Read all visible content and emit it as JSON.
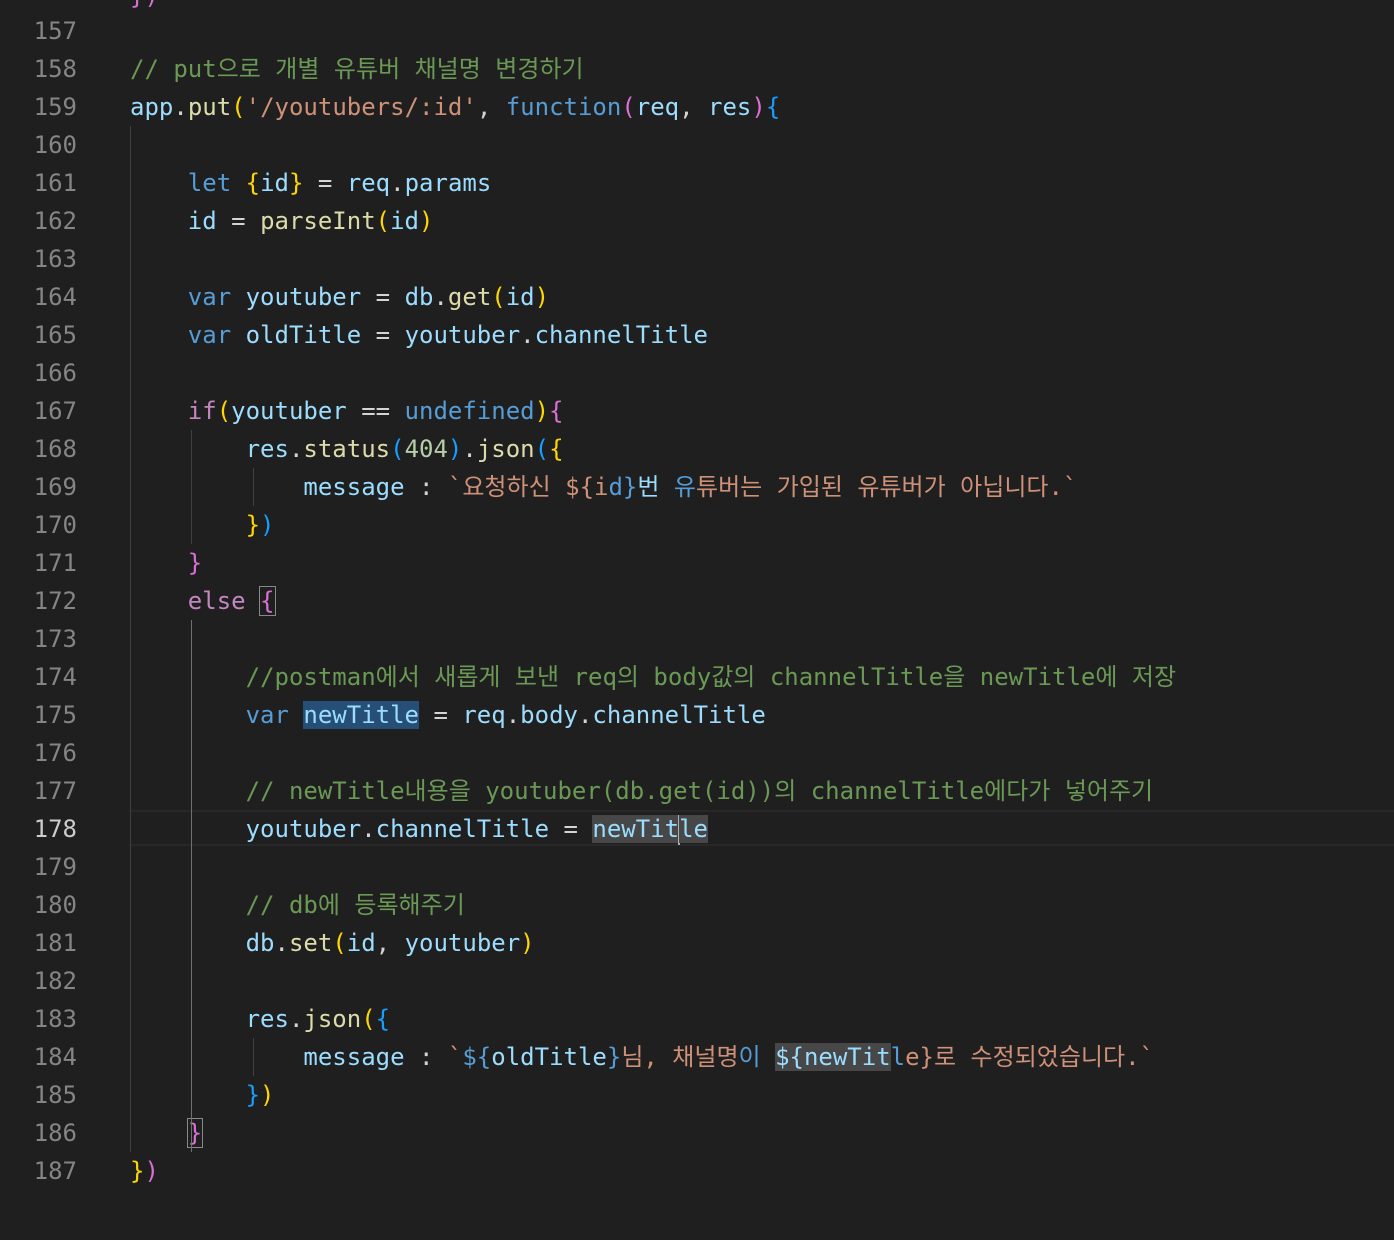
{
  "editor": {
    "active_line": "178",
    "top_partial": "})",
    "lines": [
      {
        "num": "157",
        "code": ""
      },
      {
        "num": "158",
        "code": "// put으로 개별 유튜버 채널명 변경하기"
      },
      {
        "num": "159",
        "code": "app.put('/youtubers/:id', function(req, res){"
      },
      {
        "num": "160",
        "code": ""
      },
      {
        "num": "161",
        "code": "    let {id} = req.params"
      },
      {
        "num": "162",
        "code": "    id = parseInt(id)"
      },
      {
        "num": "163",
        "code": ""
      },
      {
        "num": "164",
        "code": "    var youtuber = db.get(id)"
      },
      {
        "num": "165",
        "code": "    var oldTitle = youtuber.channelTitle"
      },
      {
        "num": "166",
        "code": ""
      },
      {
        "num": "167",
        "code": "    if(youtuber == undefined){"
      },
      {
        "num": "168",
        "code": "        res.status(404).json({"
      },
      {
        "num": "169",
        "code": "            message : `요청하신 ${id}번 유튜버는 가입된 유튜버가 아닙니다.`"
      },
      {
        "num": "170",
        "code": "        })"
      },
      {
        "num": "171",
        "code": "    }"
      },
      {
        "num": "172",
        "code": "    else {"
      },
      {
        "num": "173",
        "code": ""
      },
      {
        "num": "174",
        "code": "        //postman에서 새롭게 보낸 req의 body값의 channelTitle을 newTitle에 저장"
      },
      {
        "num": "175",
        "code": "        var newTitle = req.body.channelTitle"
      },
      {
        "num": "176",
        "code": ""
      },
      {
        "num": "177",
        "code": "        // newTitle내용을 youtuber(db.get(id))의 channelTitle에다가 넣어주기"
      },
      {
        "num": "178",
        "code": "        youtuber.channelTitle = newTitle"
      },
      {
        "num": "179",
        "code": ""
      },
      {
        "num": "180",
        "code": "        // db에 등록해주기"
      },
      {
        "num": "181",
        "code": "        db.set(id, youtuber)"
      },
      {
        "num": "182",
        "code": ""
      },
      {
        "num": "183",
        "code": "        res.json({"
      },
      {
        "num": "184",
        "code": "            message : `${oldTitle}님, 채널명이 ${newTitle}로 수정되었습니다.`"
      },
      {
        "num": "185",
        "code": "        })"
      },
      {
        "num": "186",
        "code": "    }"
      },
      {
        "num": "187",
        "code": "})"
      }
    ]
  },
  "colors": {
    "background": "#1f1f1f",
    "line_number": "#858585",
    "comment": "#6a9955",
    "keyword": "#569cd6",
    "function": "#dcdcaa",
    "variable": "#9cdcfe",
    "string": "#ce9178"
  }
}
